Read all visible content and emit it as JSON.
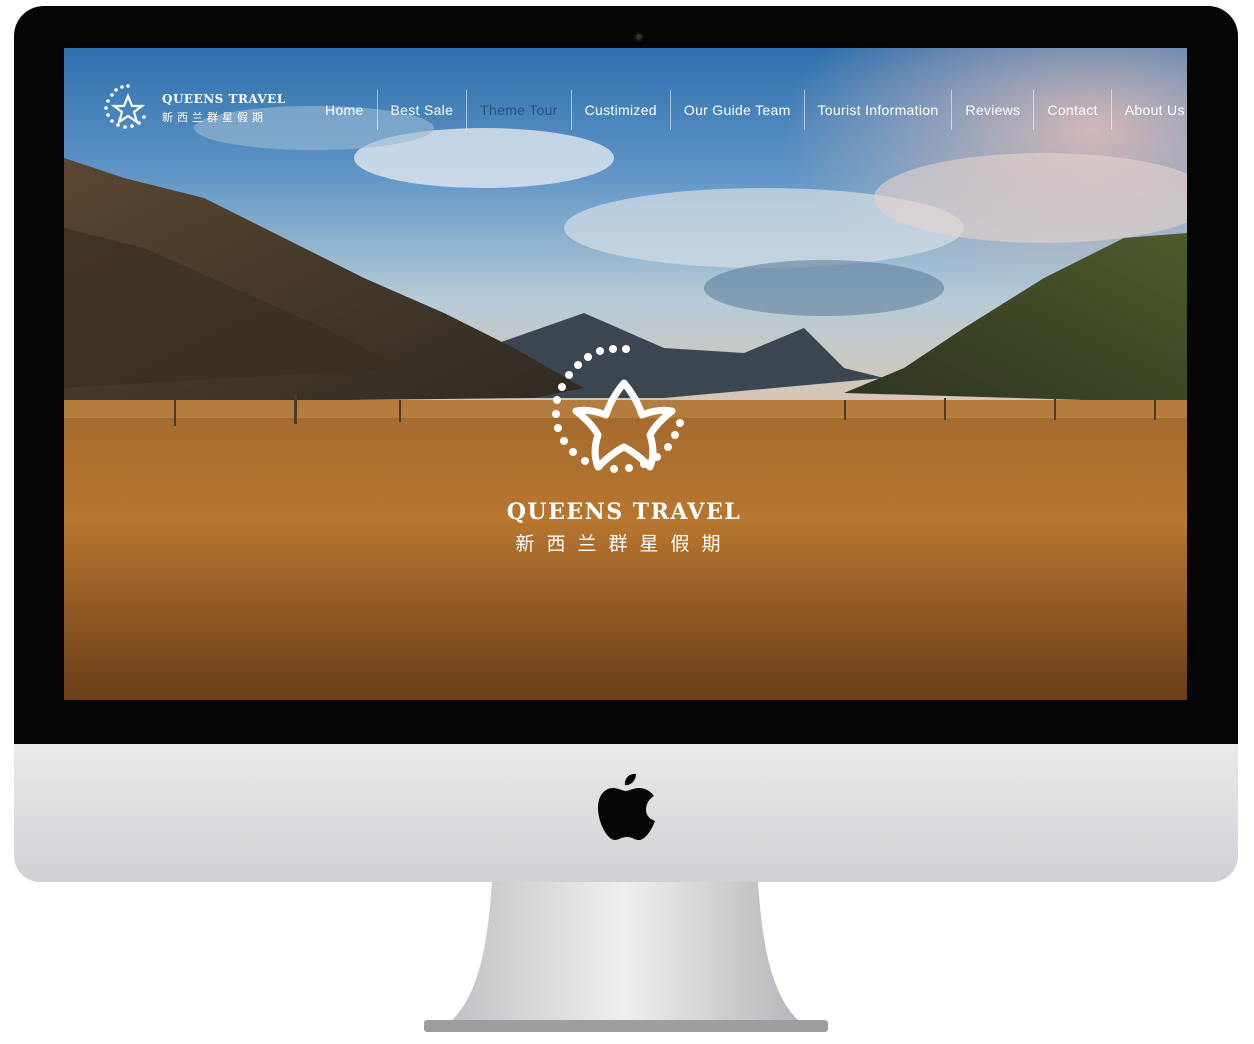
{
  "site": {
    "brand_name": "QUEENS TRAVEL",
    "brand_name_cn": "新西兰群星假期"
  },
  "nav": {
    "items": [
      {
        "label": "Home"
      },
      {
        "label": "Best Sale"
      },
      {
        "label": "Theme Tour"
      },
      {
        "label": "Custimized"
      },
      {
        "label": "Our Guide Team"
      },
      {
        "label": "Tourist Information"
      },
      {
        "label": "Reviews"
      },
      {
        "label": "Contact"
      },
      {
        "label": "About Us"
      }
    ],
    "active_index": 2
  },
  "hero": {
    "brand_name": "QUEENS TRAVEL",
    "brand_name_cn": "新西兰群星假期"
  },
  "colors": {
    "active_nav": "#2e4f7e",
    "text": "#ffffff"
  }
}
